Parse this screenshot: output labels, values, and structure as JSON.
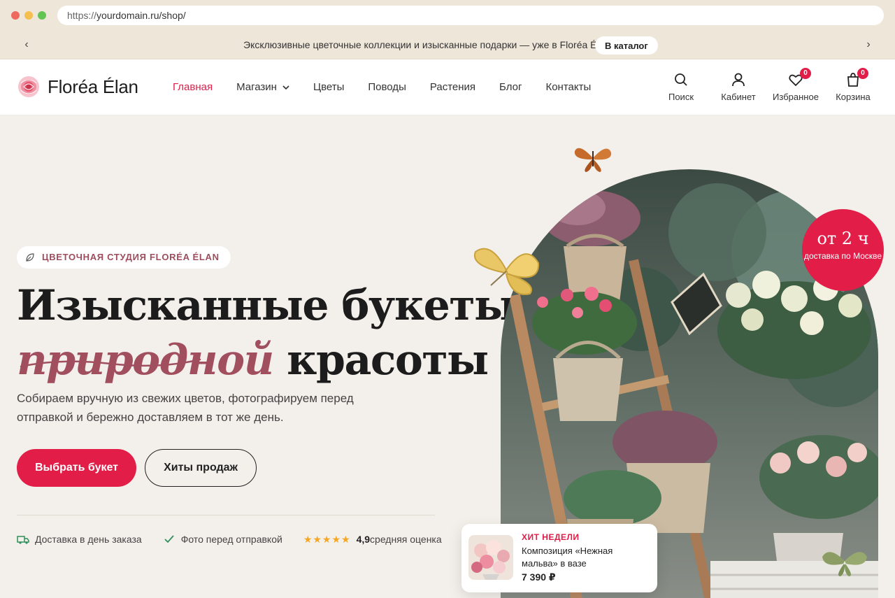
{
  "browser": {
    "url_prefix": "https://",
    "url_path": "yourdomain.ru/shop/"
  },
  "promo": {
    "text": "Эксклюзивные цветочные коллекции и изысканные подарки — уже в Floréa Élan.",
    "button": "В каталог",
    "prev": "‹",
    "next": "›"
  },
  "header": {
    "logo": "Floréa Élan",
    "nav": [
      {
        "label": "Главная",
        "active": true
      },
      {
        "label": "Магазин"
      },
      {
        "label": "Цветы"
      },
      {
        "label": "Поводы"
      },
      {
        "label": "Растения"
      },
      {
        "label": "Блог"
      },
      {
        "label": "Контакты"
      }
    ],
    "actions": {
      "search": "Поиск",
      "account": "Кабинет",
      "wishlist": "Избранное",
      "wishlist_count": "0",
      "cart": "Корзина",
      "cart_count": "0"
    }
  },
  "hero": {
    "eyebrow": "ЦВЕТОЧНАЯ СТУДИЯ FLORÉA ÉLAN",
    "headline_line1": "Изысканные букеты",
    "headline_accent": "природной",
    "headline_line2_rest": " красоты",
    "subtitle": "Собираем вручную из свежих цветов, фотографируем перед отправкой и бережно доставляем в тот же день.",
    "primary_cta": "Выбрать букет",
    "secondary_cta": "Хиты продаж",
    "features": {
      "delivery": "Доставка в день заказа",
      "photo": "Фото перед отправкой",
      "stars": "★★★★★",
      "rating_value": "4,9",
      "rating_label": " средняя оценка"
    },
    "delivery_badge": {
      "big": "от 2 ч",
      "small": "доставка по Москве"
    },
    "hit_card": {
      "tag": "ХИТ НЕДЕЛИ",
      "title": "Композиция «Нежная мальва» в вазе",
      "price": "7 390 ₽"
    }
  },
  "colors": {
    "accent": "#e11d48",
    "accent_muted": "#a14f5f",
    "background": "#f3efea",
    "topbar": "#efe6da"
  }
}
